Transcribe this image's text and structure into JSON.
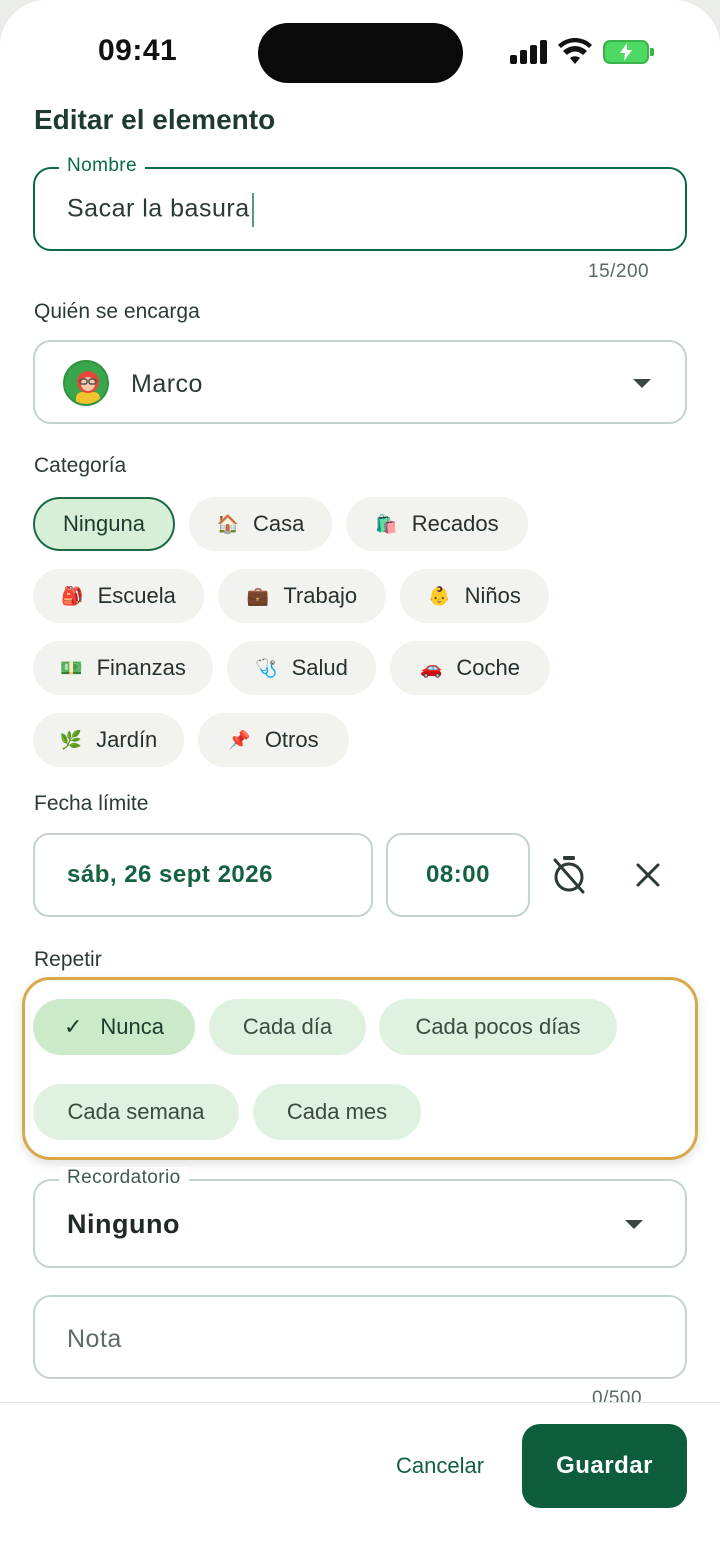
{
  "status_bar": {
    "time": "09:41"
  },
  "page": {
    "title": "Editar el elemento"
  },
  "name_field": {
    "label": "Nombre",
    "value": "Sacar la basura",
    "counter": "15/200"
  },
  "assignee": {
    "label": "Quién se encarga",
    "value": "Marco"
  },
  "category": {
    "label": "Categoría",
    "options": [
      {
        "emoji": "",
        "label": "Ninguna",
        "selected": true
      },
      {
        "emoji": "🏠",
        "label": "Casa"
      },
      {
        "emoji": "🛍️",
        "label": "Recados"
      },
      {
        "emoji": "🎒",
        "label": "Escuela"
      },
      {
        "emoji": "💼",
        "label": "Trabajo"
      },
      {
        "emoji": "👶",
        "label": "Niños"
      },
      {
        "emoji": "💵",
        "label": "Finanzas"
      },
      {
        "emoji": "🩺",
        "label": "Salud"
      },
      {
        "emoji": "🚗",
        "label": "Coche"
      },
      {
        "emoji": "🌿",
        "label": "Jardín"
      },
      {
        "emoji": "📌",
        "label": "Otros"
      }
    ]
  },
  "deadline": {
    "label": "Fecha límite",
    "date": "sáb, 26 sept 2026",
    "time": "08:00"
  },
  "repeat": {
    "label": "Repetir",
    "options": [
      {
        "label": "Nunca",
        "selected": true
      },
      {
        "label": "Cada día"
      },
      {
        "label": "Cada pocos días"
      },
      {
        "label": "Cada semana"
      },
      {
        "label": "Cada mes"
      }
    ]
  },
  "reminder": {
    "label": "Recordatorio",
    "value": "Ninguno"
  },
  "note": {
    "placeholder": "Nota",
    "counter": "0/500"
  },
  "actions": {
    "cancel": "Cancelar",
    "save": "Guardar"
  },
  "colors": {
    "accent": "#0d5c3b",
    "highlight": "#d9a84b",
    "chip_selected": "#d6efd6"
  }
}
